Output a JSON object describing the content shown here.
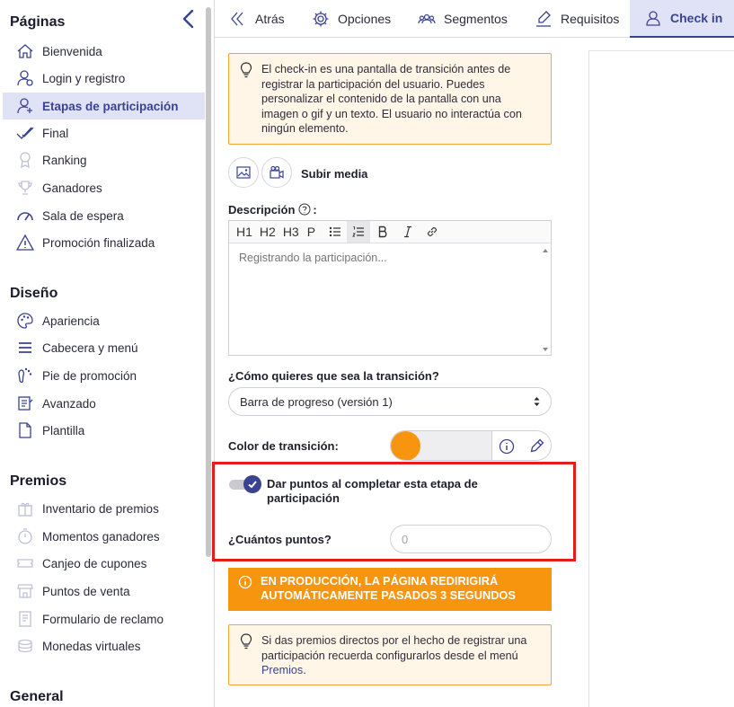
{
  "sidebar": {
    "sections": {
      "paginas": "Páginas",
      "diseno": "Diseño",
      "premios": "Premios",
      "general": "General"
    },
    "paginas_items": [
      {
        "label": "Bienvenida",
        "icon": "home-icon"
      },
      {
        "label": "Login y registro",
        "icon": "user-login-icon"
      },
      {
        "label": "Etapas de participación",
        "icon": "user-add-icon",
        "active": true
      },
      {
        "label": "Final",
        "icon": "double-check-icon"
      },
      {
        "label": "Ranking",
        "icon": "medal-icon"
      },
      {
        "label": "Ganadores",
        "icon": "trophy-icon"
      },
      {
        "label": "Sala de espera",
        "icon": "gauge-icon"
      },
      {
        "label": "Promoción finalizada",
        "icon": "warning-icon"
      }
    ],
    "diseno_items": [
      {
        "label": "Apariencia",
        "icon": "palette-icon"
      },
      {
        "label": "Cabecera y menú",
        "icon": "menu-icon"
      },
      {
        "label": "Pie de promoción",
        "icon": "footprint-icon"
      },
      {
        "label": "Avanzado",
        "icon": "advanced-icon"
      },
      {
        "label": "Plantilla",
        "icon": "document-icon"
      }
    ],
    "premios_items": [
      {
        "label": "Inventario de premios",
        "icon": "gift-icon"
      },
      {
        "label": "Momentos ganadores",
        "icon": "stopwatch-icon"
      },
      {
        "label": "Canjeo de cupones",
        "icon": "coupon-icon"
      },
      {
        "label": "Puntos de venta",
        "icon": "store-icon"
      },
      {
        "label": "Formulario de reclamo",
        "icon": "claim-icon"
      },
      {
        "label": "Monedas virtuales",
        "icon": "coins-icon"
      }
    ]
  },
  "tabs": [
    {
      "label": "Atrás",
      "icon": "back-chevrons-icon"
    },
    {
      "label": "Opciones",
      "icon": "gear-icon"
    },
    {
      "label": "Segmentos",
      "icon": "users-group-icon"
    },
    {
      "label": "Requisitos",
      "icon": "signature-icon"
    },
    {
      "label": "Check in",
      "icon": "user-check-icon",
      "active": true
    }
  ],
  "main": {
    "info_text": "El check-in es una pantalla de transición antes de registrar la participación del usuario. Puedes personalizar el contenido de la pantalla con una imagen o gif y un texto. El usuario no interactúa con ningún elemento.",
    "upload_label": "Subir media",
    "description_label": "Descripción",
    "description_suffix": ":",
    "toolbar": [
      "H1",
      "H2",
      "H3",
      "P"
    ],
    "editor_placeholder": "Registrando la participación...",
    "transition_question": "¿Cómo quieres que sea la transición?",
    "transition_value": "Barra de progreso (versión 1)",
    "color_label": "Color de transición:",
    "color_value": "#f7950f",
    "points_toggle_label": "Dar puntos al completar esta etapa de participación",
    "points_toggle_on": true,
    "points_question": "¿Cuántos puntos?",
    "points_placeholder": "0",
    "production_banner": "EN PRODUCCIÓN, LA PÁGINA REDIRIGIRÁ AUTOMÁTICAMENTE PASADOS 3 SEGUNDOS",
    "prizes_note_prefix": "Si das premios directos por el hecho de registrar una participación recuerda configurarlos desde el menú ",
    "prizes_note_link": "Premios",
    "prizes_note_suffix": "."
  },
  "colors": {
    "accent": "#3a4294",
    "warning": "#f7950f",
    "highlight": "#e41c1c"
  }
}
